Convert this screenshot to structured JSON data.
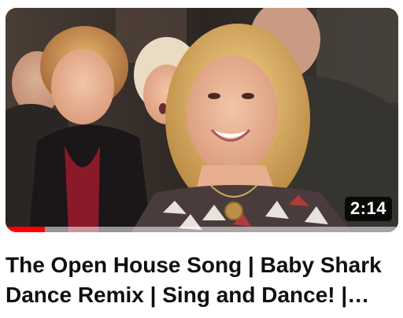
{
  "video": {
    "title": "The Open House Song | Baby Shark Dance Remix | Sing and Dance! |…",
    "duration": "2:14",
    "progress_fraction": 0.1,
    "progress_color": "#ff0000"
  }
}
